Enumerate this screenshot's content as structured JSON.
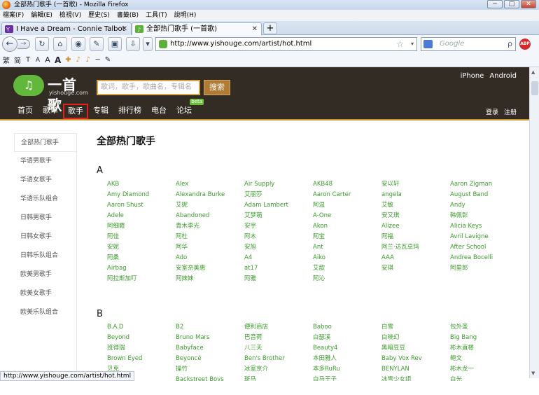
{
  "window": {
    "title": "全部热门歌手 (一首歌) - Mozilla Firefox",
    "controls": [
      "─",
      "□",
      "✕"
    ]
  },
  "menubar": [
    "檔案(F)",
    "編輯(E)",
    "檢視(V)",
    "歷史(S)",
    "書籤(B)",
    "工具(T)",
    "說明(H)"
  ],
  "tabs": [
    {
      "label": "I Have a Dream - Connie Talbot",
      "icon": "yahoo-icon",
      "close": "✕"
    },
    {
      "label": "全部热门歌手 (一首歌)",
      "icon": "yishouge-icon",
      "close": "✕"
    }
  ],
  "newtab": "+",
  "nav": {
    "back": "←",
    "forward": "→",
    "reload": "↻",
    "home": "⌂",
    "url": "http://www.yishouge.com/artist/hot.html",
    "search_placeholder": "Google",
    "star": "☆",
    "dropdown": "▾",
    "search_glyph": "ρ",
    "abp": "ABP"
  },
  "bookmarks": [
    "繁",
    "简",
    "T",
    "A",
    "A",
    "A",
    "✚",
    "♪",
    "♪",
    "─",
    "✎"
  ],
  "site": {
    "logo_text": "一首歌",
    "logo_domain": "yishouge.com",
    "search_placeholder": "歌词，歌手，歌曲名，专辑名",
    "search_button": "搜索",
    "device_links": [
      "iPhone",
      "Android"
    ],
    "nav": [
      {
        "label": "首页"
      },
      {
        "label": "歌单"
      },
      {
        "label": "歌手"
      },
      {
        "label": "专辑"
      },
      {
        "label": "排行榜"
      },
      {
        "label": "电台"
      },
      {
        "label": "论坛",
        "badge": "beta"
      }
    ],
    "auth": [
      "登录",
      "注册"
    ]
  },
  "sidebar": [
    "全部热门歌手",
    "华语男歌手",
    "华语女歌手",
    "华语乐队组合",
    "日韩男歌手",
    "日韩女歌手",
    "日韩乐队组合",
    "欧美男歌手",
    "欧美女歌手",
    "欧美乐队组合"
  ],
  "main": {
    "heading": "全部热门歌手",
    "sections": [
      {
        "letter": "A",
        "artists": [
          "AKB",
          "Alex",
          "Air Supply",
          "AKB48",
          "安以轩",
          "Aaron Zigman",
          "Amy Diamond",
          "Alexandra Burke",
          "艾丽莎",
          "Aaron Carter",
          "angela",
          "August Band",
          "Aaron Shust",
          "艾妮",
          "Adam Lambert",
          "阿温",
          "艾敏",
          "Andy",
          "Adele",
          "Abandoned",
          "艾梦萌",
          "A-One",
          "安又琪",
          "韩佩彰",
          "阿细霞",
          "青木李光",
          "安宇",
          "Akon",
          "Alizee",
          "Alicia Keys",
          "阿佳",
          "阿杜",
          "阿木",
          "阿宝",
          "阿福",
          "Avril Lavigne",
          "安妮",
          "阿华",
          "安旭",
          "Ant",
          "阿兰·达瓦卓玛",
          "After School",
          "阿桑",
          "Ado",
          "A4",
          "Aiko",
          "AAA",
          "Andrea Bocelli",
          "Airbag",
          "安室奈美惠",
          "at17",
          "艾歆",
          "安琪",
          "阿里郎",
          "阿拉斯加叮",
          "阿妹妹",
          "阿雅",
          "阿沁"
        ]
      },
      {
        "letter": "B",
        "artists": [
          "B.A.D",
          "B2",
          "便利商店",
          "Baboo",
          "白雪",
          "包外圣",
          "Beyond",
          "Bruno Mars",
          "巴音荷",
          "白瑟溪",
          "白晓幻",
          "Big Bang",
          "班得瑞",
          "Babyface",
          "八三夭",
          "Beauty4",
          "黑暗豆豆",
          "彬木直楼",
          "Brown Eyed",
          "Beyoncé",
          "Ben's Brother",
          "本田雅人",
          "Baby Vox Rev",
          "鲍文",
          "贝克",
          "操竹",
          "冰室京介",
          "本多RuRu",
          "BENYLAN",
          "彬木龙一",
          "B.O.X",
          "Backstreet Boys",
          "斑马",
          "白马王子",
          "冰雪少女组",
          "白光"
        ]
      }
    ]
  },
  "status": {
    "text": "http://www.yishouge.com/artist/hot.html"
  },
  "colors": {
    "site_header": "#322c25",
    "link_green": "#3a9c2a",
    "highlight_red": "#e0201c",
    "accent_orange": "#c9962d"
  }
}
